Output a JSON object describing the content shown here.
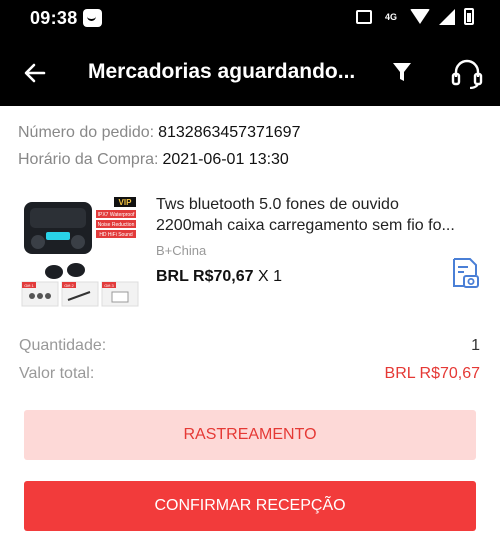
{
  "status_bar": {
    "time": "09:38",
    "network": "4G"
  },
  "app_bar": {
    "title": "Mercadorias aguardando...",
    "icons": [
      "back-arrow-icon",
      "filter-icon",
      "customer-support-headset-icon"
    ]
  },
  "order": {
    "number_label": "Número do pedido:",
    "number_value": "8132863457371697",
    "date_label": "Horário da Compra:",
    "date_value": "2021-06-01 13:30"
  },
  "product": {
    "title_line1": "Tws bluetooth 5.0 fones de ouvido",
    "title_line2": "2200mah caixa carregamento sem fio fo...",
    "origin": "B+China",
    "price": "BRL R$70,67",
    "quantity_text": "X 1",
    "image_badge": "VIP",
    "image_tags": [
      "IPX7 Waterproof",
      "Noise Reduction",
      "HD HiFi Sound"
    ],
    "image_gifts": [
      "Gift 1",
      "Gift 2",
      "Gift 3"
    ]
  },
  "summary": {
    "quantity_label": "Quantidade:",
    "quantity_value": "1",
    "total_label": "Valor total:",
    "total_value": "BRL R$70,67"
  },
  "actions": {
    "track_label": "RASTREAMENTO",
    "confirm_label": "CONFIRMAR RECEPÇÃO"
  },
  "colors": {
    "accent_red": "#f23b3b",
    "light_red": "#fdd9d7",
    "price_red": "#e53935",
    "invoice_blue": "#4a7fd6"
  }
}
